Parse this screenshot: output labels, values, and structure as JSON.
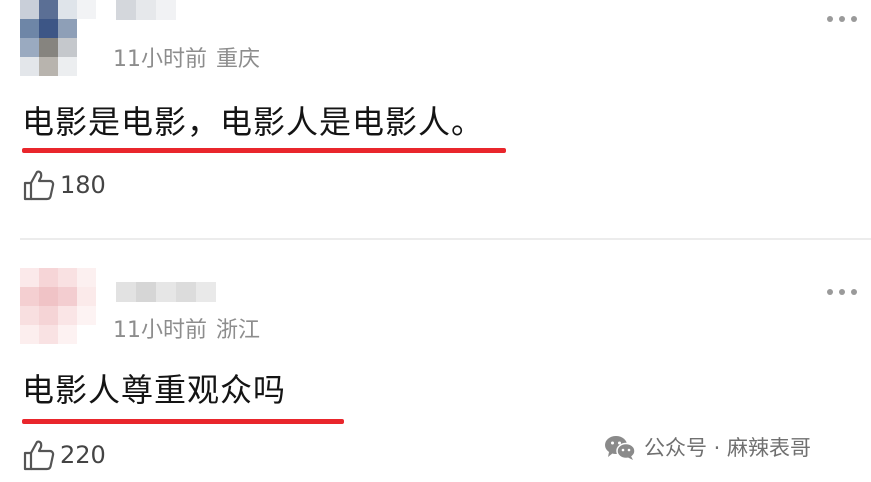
{
  "comments": [
    {
      "time": "11小时前",
      "location": "重庆",
      "text": "电影是电影，电影人是电影人。",
      "likes": "180"
    },
    {
      "time": "11小时前",
      "location": "浙江",
      "text": "电影人尊重观众吗",
      "likes": "220"
    }
  ],
  "watermark": {
    "text": "公众号 · 麻辣表哥"
  },
  "colors": {
    "underline": "#e9262c",
    "meta_text": "#8d8d8d",
    "divider": "#ececec"
  },
  "icons": [
    "thumbs-up-icon",
    "more-options-icon",
    "wechat-icon"
  ]
}
